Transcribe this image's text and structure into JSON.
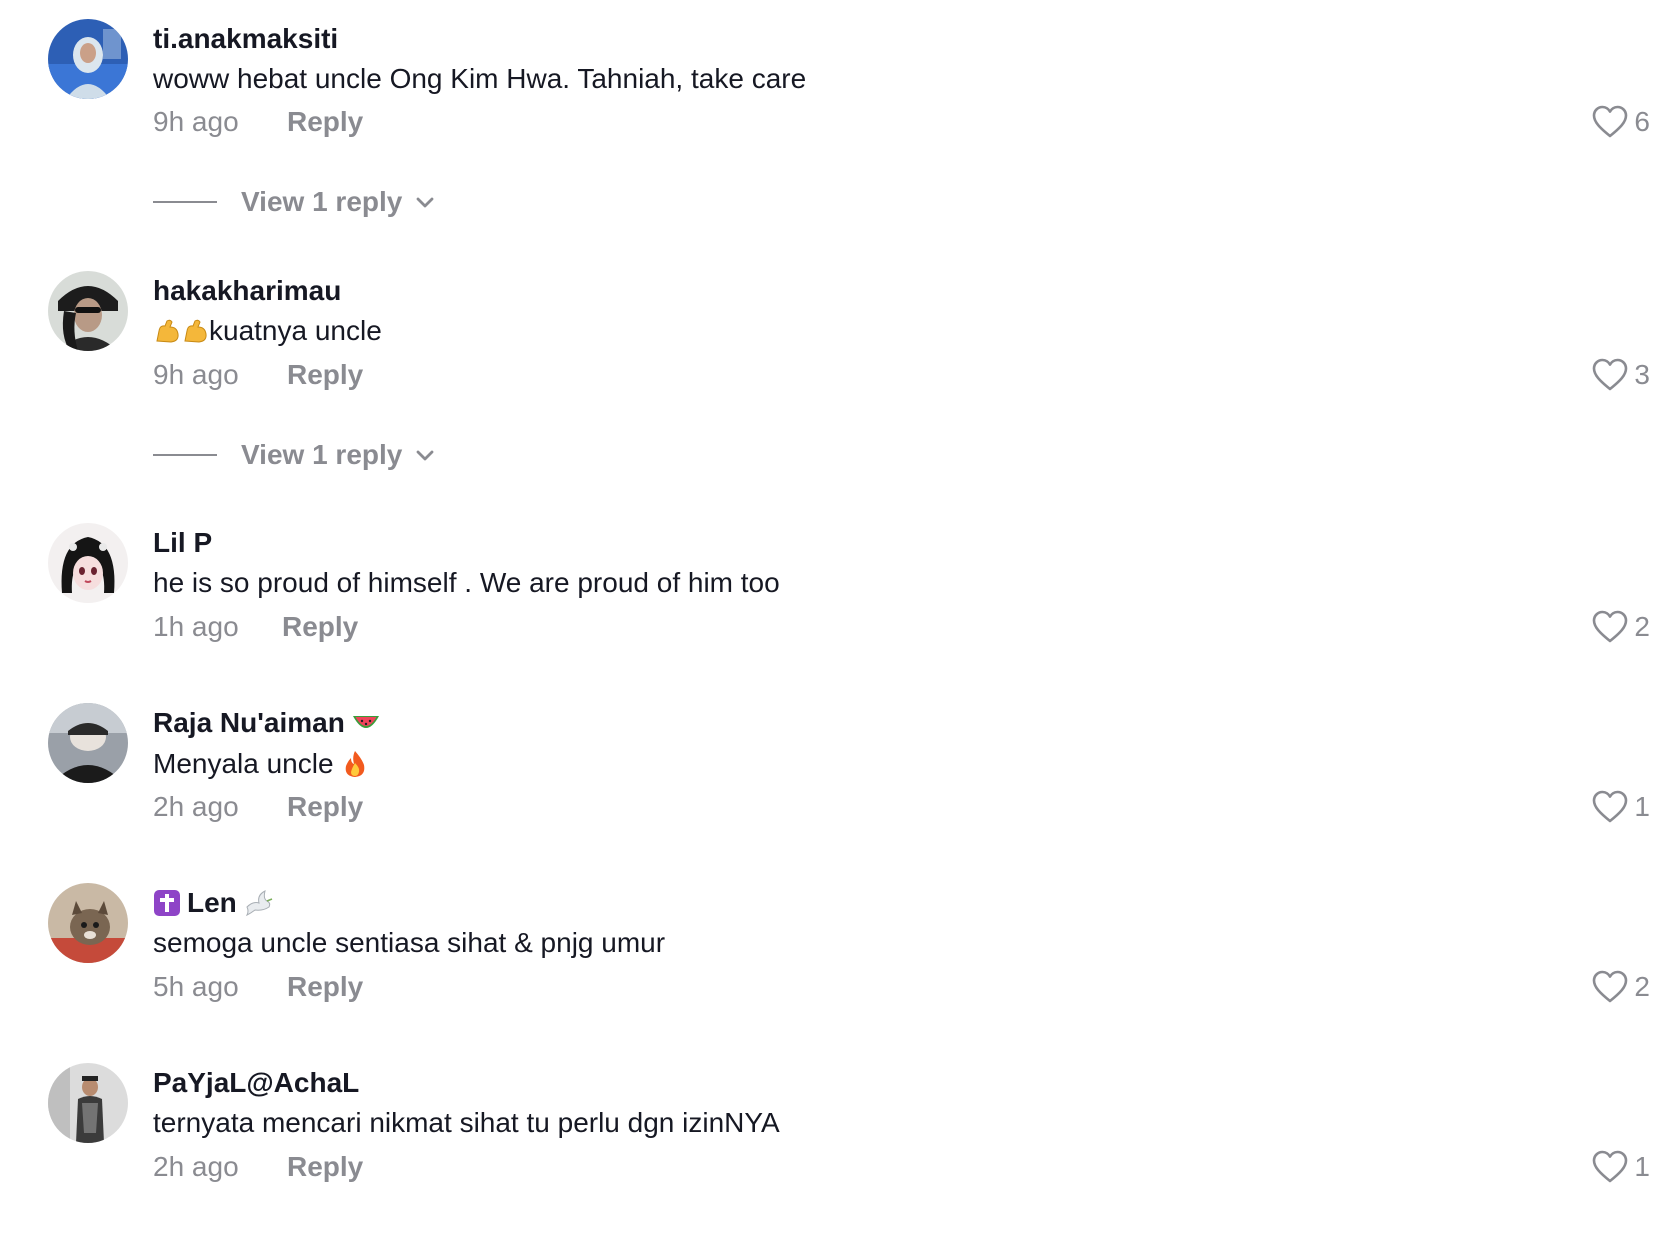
{
  "comments": [
    {
      "username": "ti.anakmaksiti",
      "text": "woww hebat uncle Ong Kim Hwa. Tahniah, take care",
      "time": "9h ago",
      "reply_label": "Reply",
      "likes": "6",
      "view_replies": "View 1 reply"
    },
    {
      "username": "hakakharimau",
      "text": "kuatnya uncle",
      "text_prefix_emoji": "flexed-biceps-icon x2",
      "time": "9h ago",
      "reply_label": "Reply",
      "likes": "3",
      "view_replies": "View 1 reply"
    },
    {
      "username": "Lil P",
      "text": "he is so proud of himself . We are proud of him too",
      "time": "1h ago",
      "reply_label": "Reply",
      "likes": "2"
    },
    {
      "username": "Raja Nu'aiman",
      "username_suffix_emoji": "watermelon-icon",
      "text": "Menyala uncle",
      "text_suffix_emoji": "fire-icon",
      "time": "2h ago",
      "reply_label": "Reply",
      "likes": "1"
    },
    {
      "username": "Len",
      "username_prefix_emoji": "latin-cross-icon",
      "username_suffix_emoji": "dove-icon",
      "text": "semoga uncle sentiasa sihat & pnjg umur",
      "time": "5h ago",
      "reply_label": "Reply",
      "likes": "2"
    },
    {
      "username": "PaYjaL@AchaL",
      "text": "ternyata mencari nikmat sihat tu perlu dgn izinNYA",
      "time": "2h ago",
      "reply_label": "Reply",
      "likes": "1"
    }
  ],
  "colors": {
    "primary_text": "#161823",
    "secondary_text": "#8a8b91",
    "background": "#ffffff"
  }
}
